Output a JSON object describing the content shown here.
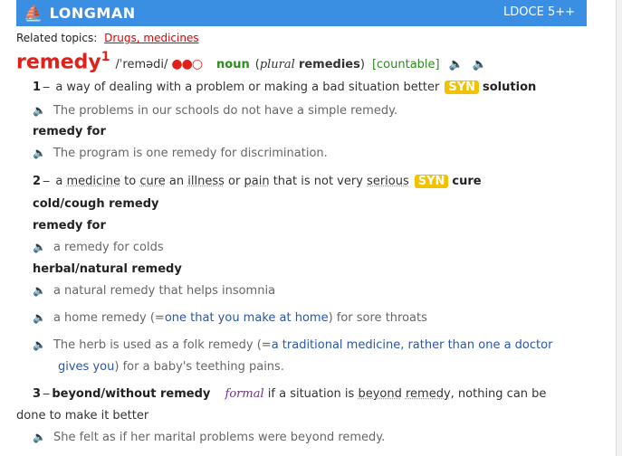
{
  "app": {
    "brand": "LONGMAN",
    "edition": "LDOCE 5++"
  },
  "related": {
    "label": "Related topics:",
    "link": "Drugs, medicines"
  },
  "entry": {
    "headword": "remedy",
    "homnum": "1",
    "pron": "/ˈremədi/",
    "freq": "●●○",
    "pos": "noun",
    "plural_open": "(",
    "plural_label": "plural",
    "plural_form": "remedies",
    "plural_close": ")",
    "gram": "[countable]",
    "speaker_uk": "🔈",
    "speaker_us": "🔈"
  },
  "senses": [
    {
      "num": "1",
      "def": "a way of dealing with a problem or making a bad situation better",
      "syn_label": "SYN",
      "syn": "solution",
      "ex1": "The problems in our schools do not have a simple remedy.",
      "colloc": "remedy for",
      "ex2": "The program is one remedy for discrimination."
    },
    {
      "num": "2",
      "def_a": "a",
      "def_b": "medicine",
      "def_c": "to",
      "def_d": "cure",
      "def_e": "an",
      "def_f": "illness",
      "def_g": "or",
      "def_h": "pain",
      "def_i": "that is not very",
      "def_j": "serious",
      "syn_label": "SYN",
      "syn": "cure",
      "colloc1": "cold/cough remedy",
      "colloc2": "remedy for",
      "ex1": "a remedy for colds",
      "colloc3": "herbal/natural remedy",
      "ex2": "a natural remedy that helps insomnia",
      "ex3_a": "a home remedy (=",
      "ex3_b": "one that you make at home",
      "ex3_c": ") for sore throats",
      "ex4_a": "The herb is used as a folk remedy (=",
      "ex4_b": "a traditional medicine, rather than one a doctor",
      "ex4_c": "gives you",
      "ex4_d": ") for a baby's teething pains."
    },
    {
      "num": "3",
      "phrase": "beyond/without remedy",
      "register": "formal",
      "def_a": "if a situation is",
      "def_b": "beyond",
      "def_c": "remedy",
      "def_d": ", nothing can be",
      "def_e": "done to make it better",
      "ex1": "She felt as if her marital problems were beyond remedy."
    }
  ],
  "colors": {
    "header": "#3b8fe3",
    "headword": "#e0201b",
    "pos": "#2e8b1e",
    "syn": "#f2c200",
    "link": "#2a56a6"
  }
}
